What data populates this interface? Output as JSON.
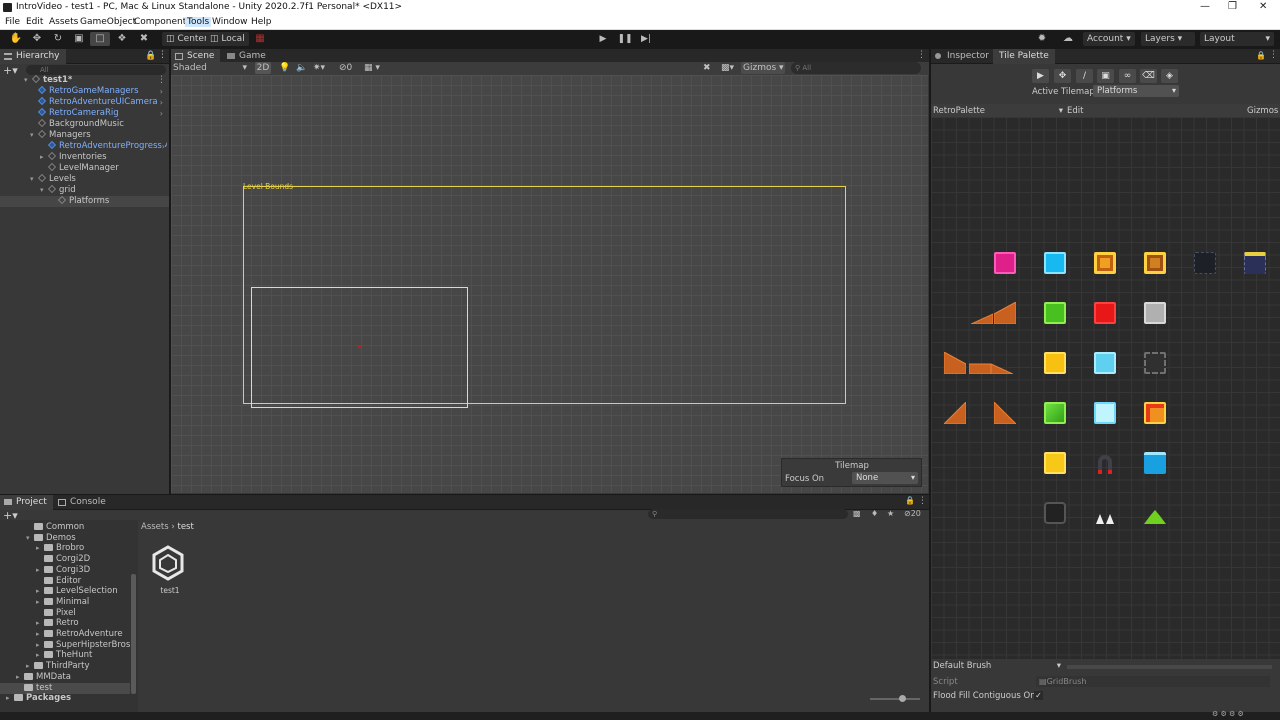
{
  "window": {
    "title": "IntroVideo - test1 - PC, Mac & Linux Standalone - Unity 2020.2.7f1 Personal* <DX11>"
  },
  "menu": [
    "File",
    "Edit",
    "Assets",
    "GameObject",
    "Component",
    "Tools",
    "Window",
    "Help"
  ],
  "toolbar": {
    "pivot": "Center",
    "space": "Local",
    "account": "Account",
    "layers": "Layers",
    "layout": "Layout"
  },
  "hierarchy": {
    "tab": "Hierarchy",
    "search_placeholder": "All",
    "items": [
      {
        "label": "test1*",
        "prefab": false
      },
      {
        "label": "RetroGameManagers",
        "prefab": true
      },
      {
        "label": "RetroAdventureUICamera",
        "prefab": true
      },
      {
        "label": "RetroCameraRig",
        "prefab": true
      },
      {
        "label": "BackgroundMusic",
        "prefab": false
      },
      {
        "label": "Managers",
        "prefab": false
      },
      {
        "label": "RetroAdventureProgressM",
        "prefab": true
      },
      {
        "label": "Inventories",
        "prefab": false
      },
      {
        "label": "LevelManager",
        "prefab": false
      },
      {
        "label": "Levels",
        "prefab": false
      },
      {
        "label": "grid",
        "prefab": false
      },
      {
        "label": "Platforms",
        "prefab": false
      }
    ]
  },
  "scene": {
    "tabs": [
      "Scene",
      "Game"
    ],
    "shading": "Shaded",
    "mode2d": "2D",
    "hidden_count": "0",
    "gizmos": "Gizmos",
    "search_placeholder": "All",
    "level_bounds_label": "Level Bounds",
    "tilemap_overlay": {
      "title": "Tilemap",
      "focus_label": "Focus On",
      "focus_value": "None"
    }
  },
  "inspector": {
    "tabs": [
      "Inspector",
      "Tile Palette"
    ],
    "active_tilemap_label": "Active Tilemap",
    "active_tilemap_value": "Platforms",
    "palette_name": "RetroPalette",
    "edit_label": "Edit",
    "gizmos_label": "Gizmos",
    "brush_label": "Default Brush",
    "script_label": "Script",
    "script_value": "GridBrush",
    "flood_fill_label": "Flood Fill Contiguous Only",
    "flood_fill_checked": true
  },
  "project": {
    "tabs": [
      "Project",
      "Console"
    ],
    "breadcrumb_root": "Assets",
    "breadcrumb_current": "test",
    "hidden_count": "20",
    "tree": [
      {
        "label": "Common",
        "depth": 2
      },
      {
        "label": "Demos",
        "depth": 2
      },
      {
        "label": "Brobro",
        "depth": 3
      },
      {
        "label": "Corgi2D",
        "depth": 3
      },
      {
        "label": "Corgi3D",
        "depth": 3
      },
      {
        "label": "Editor",
        "depth": 3
      },
      {
        "label": "LevelSelection",
        "depth": 3
      },
      {
        "label": "Minimal",
        "depth": 3
      },
      {
        "label": "Pixel",
        "depth": 3
      },
      {
        "label": "Retro",
        "depth": 3
      },
      {
        "label": "RetroAdventure",
        "depth": 3
      },
      {
        "label": "SuperHipsterBros",
        "depth": 3
      },
      {
        "label": "TheHunt",
        "depth": 3
      },
      {
        "label": "ThirdParty",
        "depth": 2
      },
      {
        "label": "MMData",
        "depth": 1
      },
      {
        "label": "test",
        "depth": 1
      },
      {
        "label": "Packages",
        "depth": 0
      }
    ],
    "asset": {
      "label": "test1"
    }
  },
  "colors": {
    "accent_prefab": "#7fb0ff",
    "selection_yellow": "#e6d24a"
  }
}
